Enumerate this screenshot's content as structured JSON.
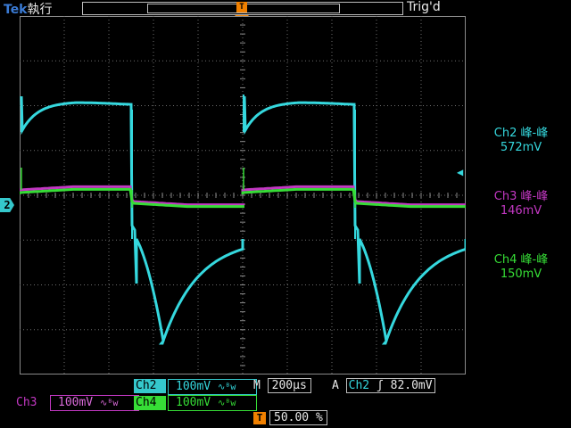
{
  "header": {
    "brand": "Tek",
    "run_state": "執行",
    "trigger_state": "Trig'd",
    "trigger_top_marker": "T"
  },
  "trigger_position_marker": "T",
  "channel_marker": "2",
  "measurements": [
    {
      "label": "Ch2 峰-峰",
      "value": "572mV",
      "color": "#35d8de"
    },
    {
      "label": "Ch3 峰-峰",
      "value": "146mV",
      "color": "#c338c3"
    },
    {
      "label": "Ch4 峰-峰",
      "value": "150mV",
      "color": "#36dd36"
    }
  ],
  "channels": {
    "ch2": {
      "label": "Ch2",
      "scale": "100mV",
      "coupling": "∿ᴮw"
    },
    "ch3": {
      "label": "Ch3",
      "scale": "100mV",
      "coupling": "∿ᴮw"
    },
    "ch4": {
      "label": "Ch4",
      "scale": "100mV",
      "coupling": "∿ᴮw"
    }
  },
  "timebase": {
    "prefix": "M",
    "value": "200µs"
  },
  "trigger": {
    "mode": "A",
    "source": "Ch2",
    "slope": "ʃ",
    "level": "82.0mV"
  },
  "horizontal_position": {
    "marker": "T",
    "value": "50.00 %"
  },
  "colors": {
    "ch2": "#35d8de",
    "ch3": "#c338c3",
    "ch4": "#36dd36",
    "trigger": "#f08000"
  }
}
